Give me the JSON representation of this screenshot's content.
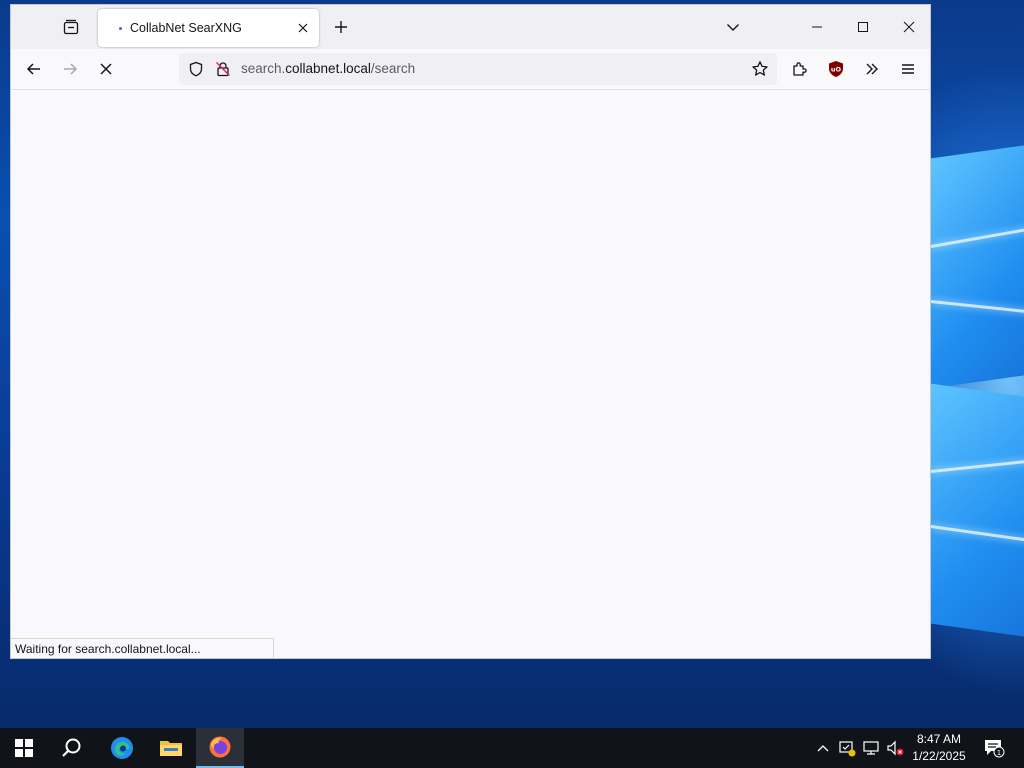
{
  "browser": {
    "tab": {
      "title": "CollabNet SearXNG"
    },
    "url": {
      "scheme_part": "search.",
      "host": "collabnet.local",
      "path": "/search"
    },
    "status_text": "Waiting for search.collabnet.local..."
  },
  "taskbar": {
    "time": "8:47 AM",
    "date": "1/22/2025",
    "notification_count": "1"
  },
  "colors": {
    "accent": "#0060df",
    "taskbar_bg": "#101418",
    "ublock_red": "#800000"
  }
}
